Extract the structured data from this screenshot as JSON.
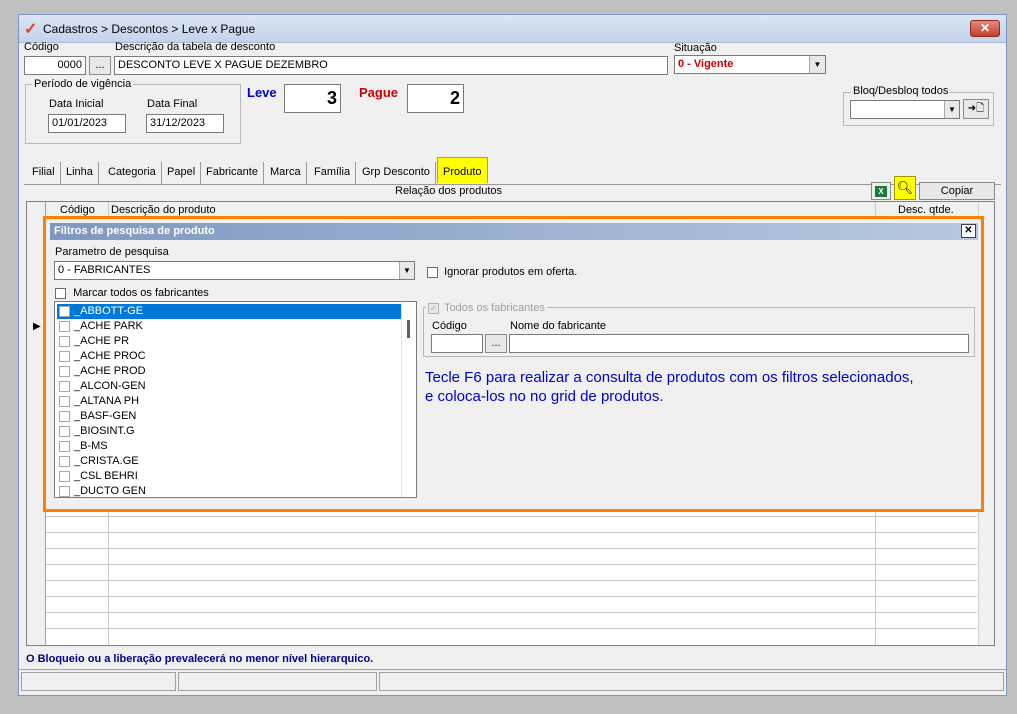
{
  "window": {
    "title": "Cadastros > Descontos > Leve x Pague",
    "close_label": "✕"
  },
  "form": {
    "codigo_label": "Código",
    "codigo_value": "0000",
    "lookup_label": "...",
    "descricao_label": "Descrição da tabela de desconto",
    "descricao_value": "DESCONTO LEVE X PAGUE DEZEMBRO",
    "situacao_label": "Situação",
    "situacao_value": "0 - Vigente",
    "periodo_label": "Período de vigência",
    "data_inicial_label": "Data Inicial",
    "data_inicial_value": "01/01/2023",
    "data_final_label": "Data Final",
    "data_final_value": "31/12/2023",
    "leve_label": "Leve",
    "leve_value": "3",
    "pague_label": "Pague",
    "pague_value": "2",
    "bloq_label": "Bloq/Desbloq todos",
    "bloq_button_label": "➜🗋",
    "colors": {
      "leve": "#0000cc",
      "pague": "#cc0000",
      "situacao": "#cc0000"
    }
  },
  "tabs": [
    {
      "label": "Filial"
    },
    {
      "label": "Linha"
    },
    {
      "label": "Categoria"
    },
    {
      "label": "Papel"
    },
    {
      "label": "Fabricante"
    },
    {
      "label": "Marca"
    },
    {
      "label": "Família"
    },
    {
      "label": "Grp Desconto"
    },
    {
      "label": "Produto"
    }
  ],
  "grid": {
    "title": "Relação dos produtos",
    "copy_label": "Copiar",
    "columns": [
      "Código",
      "Descrição do produto",
      "Desc. qtde."
    ]
  },
  "filter_panel": {
    "title": "Filtros de pesquisa de produto",
    "close_label": "✕",
    "param_label": "Parametro de pesquisa",
    "param_value": "0 - FABRICANTES",
    "ignore_offer_label": "Ignorar produtos em oferta.",
    "mark_all_label": "Marcar todos os fabricantes",
    "all_manufacturers_label": "Todos os fabricantes",
    "codigo_label": "Código",
    "lookup_label": "...",
    "nome_label": "Nome do fabricante",
    "hint": "Tecle F6 para realizar a consulta de produtos com os filtros selecionados, e coloca-los no no grid de produtos.",
    "manufacturers": [
      "_ABBOTT-GE",
      "_ACHE PARK",
      "_ACHE PR",
      "_ACHE PROC",
      "_ACHE PROD",
      "_ALCON-GEN",
      "_ALTANA PH",
      "_BASF-GEN",
      "_BIOSINT.G",
      "_B-MS",
      "_CRISTA.GE",
      "_CSL BEHRI",
      "_DUCTO GEN"
    ]
  },
  "status": {
    "message": "O Bloqueio ou a liberação prevalecerá no menor nível hierarquico."
  }
}
